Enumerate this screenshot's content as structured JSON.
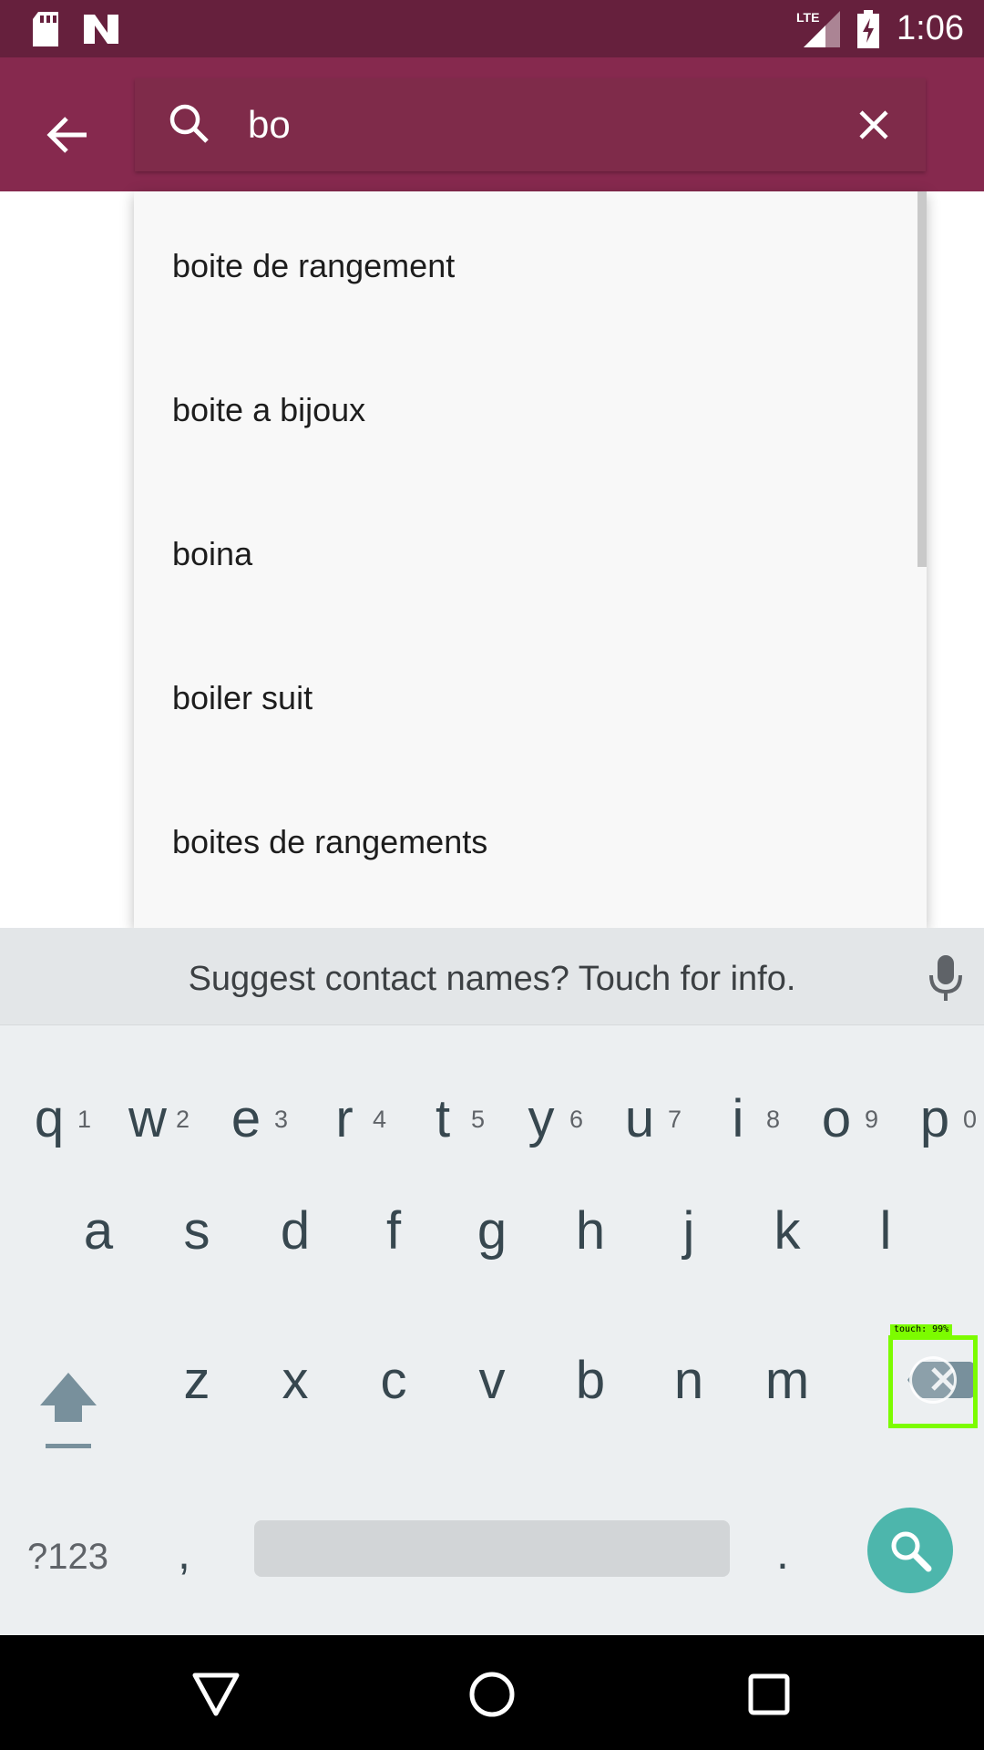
{
  "status_bar": {
    "time": "1:06",
    "icons": [
      "sd-card-icon",
      "n-notification-icon",
      "lte-signal-icon",
      "battery-charging-icon"
    ],
    "network_label": "LTE"
  },
  "app_bar": {
    "back_icon": "arrow-left-icon",
    "search_icon": "search-icon",
    "query": "bo",
    "clear_icon": "close-icon",
    "color": "#86294e"
  },
  "suggestions": [
    {
      "label": "boite de rangement"
    },
    {
      "label": "boite a bijoux"
    },
    {
      "label": "boina"
    },
    {
      "label": "boiler suit"
    },
    {
      "label": "boites de rangements"
    }
  ],
  "keyboard": {
    "suggestion_text": "Suggest contact names? Touch for info.",
    "mic_icon": "microphone-icon",
    "row1": [
      {
        "k": "q",
        "h": "1"
      },
      {
        "k": "w",
        "h": "2"
      },
      {
        "k": "e",
        "h": "3"
      },
      {
        "k": "r",
        "h": "4"
      },
      {
        "k": "t",
        "h": "5"
      },
      {
        "k": "y",
        "h": "6"
      },
      {
        "k": "u",
        "h": "7"
      },
      {
        "k": "i",
        "h": "8"
      },
      {
        "k": "o",
        "h": "9"
      },
      {
        "k": "p",
        "h": "0"
      }
    ],
    "row2": [
      "a",
      "s",
      "d",
      "f",
      "g",
      "h",
      "j",
      "k",
      "l"
    ],
    "row3": [
      "z",
      "x",
      "c",
      "v",
      "b",
      "n",
      "m"
    ],
    "symbols_label": "?123",
    "comma_label": ",",
    "period_label": ".",
    "shift_icon": "shift-icon",
    "backspace_icon": "backspace-icon",
    "search_key_icon": "search-icon",
    "search_key_color": "#4db6ac"
  },
  "touch_overlay": {
    "label": "touch: 99%",
    "color": "#7cfc00"
  },
  "nav_bar": {
    "icons": [
      "back-triangle-icon",
      "home-circle-icon",
      "recents-square-icon"
    ]
  }
}
